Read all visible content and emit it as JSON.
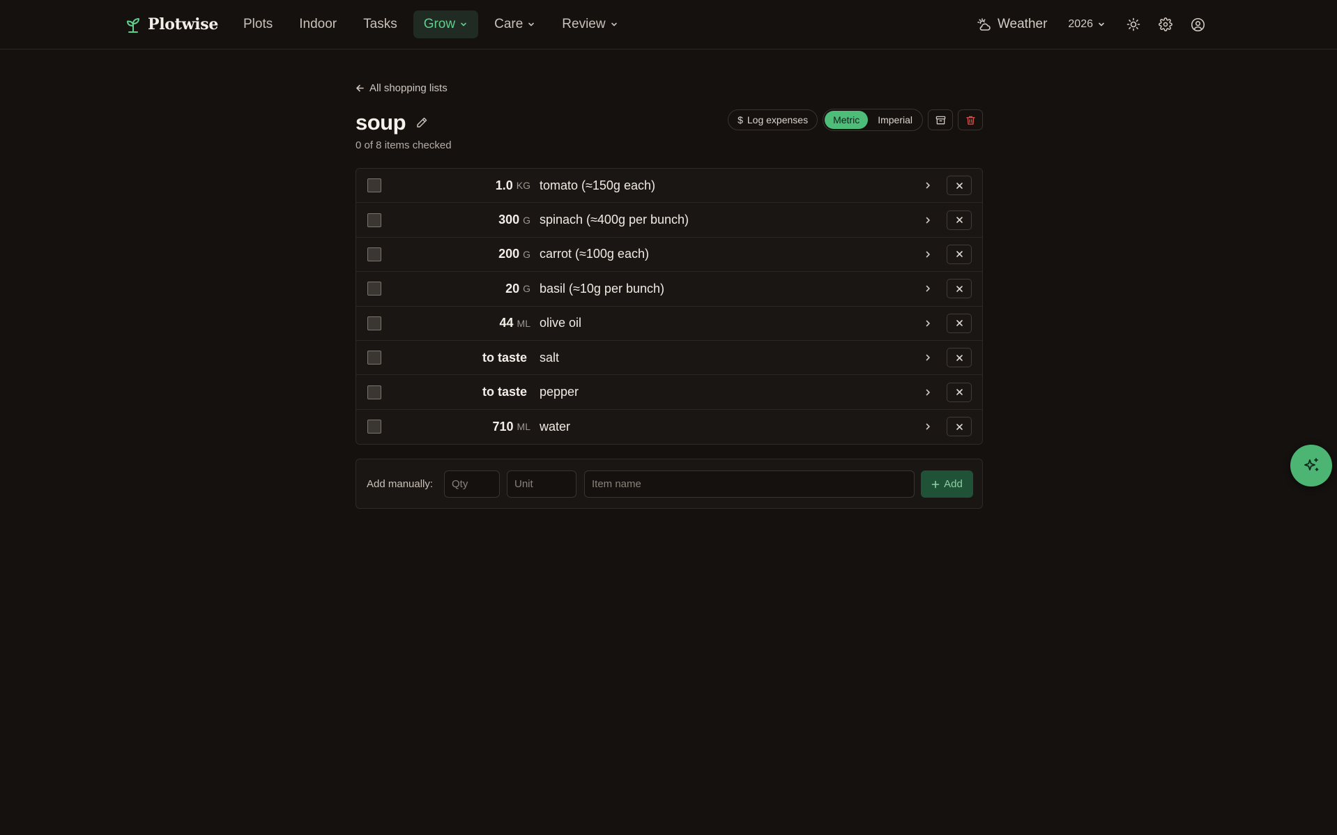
{
  "brand": {
    "name": "Plotwise",
    "icon": "sprout-icon"
  },
  "nav": {
    "items": [
      {
        "label": "Plots",
        "has_menu": false,
        "active": false
      },
      {
        "label": "Indoor",
        "has_menu": false,
        "active": false
      },
      {
        "label": "Tasks",
        "has_menu": false,
        "active": false
      },
      {
        "label": "Grow",
        "has_menu": true,
        "active": true
      },
      {
        "label": "Care",
        "has_menu": true,
        "active": false
      },
      {
        "label": "Review",
        "has_menu": true,
        "active": false
      }
    ],
    "weather_label": "Weather",
    "year": "2026"
  },
  "page": {
    "back_label": "All shopping lists",
    "title": "soup",
    "subtitle": "0 of 8 items checked"
  },
  "toolbar": {
    "log_expenses": "Log expenses",
    "metric": "Metric",
    "imperial": "Imperial",
    "selected_unit_system": "Metric"
  },
  "items": [
    {
      "qty": "1.0",
      "unit": "KG",
      "name": "tomato (≈150g each)",
      "checked": false
    },
    {
      "qty": "300",
      "unit": "G",
      "name": "spinach (≈400g per bunch)",
      "checked": false
    },
    {
      "qty": "200",
      "unit": "G",
      "name": "carrot (≈100g each)",
      "checked": false
    },
    {
      "qty": "20",
      "unit": "G",
      "name": "basil (≈10g per bunch)",
      "checked": false
    },
    {
      "qty": "44",
      "unit": "ML",
      "name": "olive oil",
      "checked": false
    },
    {
      "qty": "to taste",
      "unit": "",
      "name": "salt",
      "checked": false
    },
    {
      "qty": "to taste",
      "unit": "",
      "name": "pepper",
      "checked": false
    },
    {
      "qty": "710",
      "unit": "ML",
      "name": "water",
      "checked": false
    }
  ],
  "add_form": {
    "label": "Add manually:",
    "qty_placeholder": "Qty",
    "unit_placeholder": "Unit",
    "name_placeholder": "Item name",
    "add_label": "Add"
  },
  "colors": {
    "background": "#14110f",
    "accent_green": "#4dbd79",
    "danger": "#d9534f"
  }
}
